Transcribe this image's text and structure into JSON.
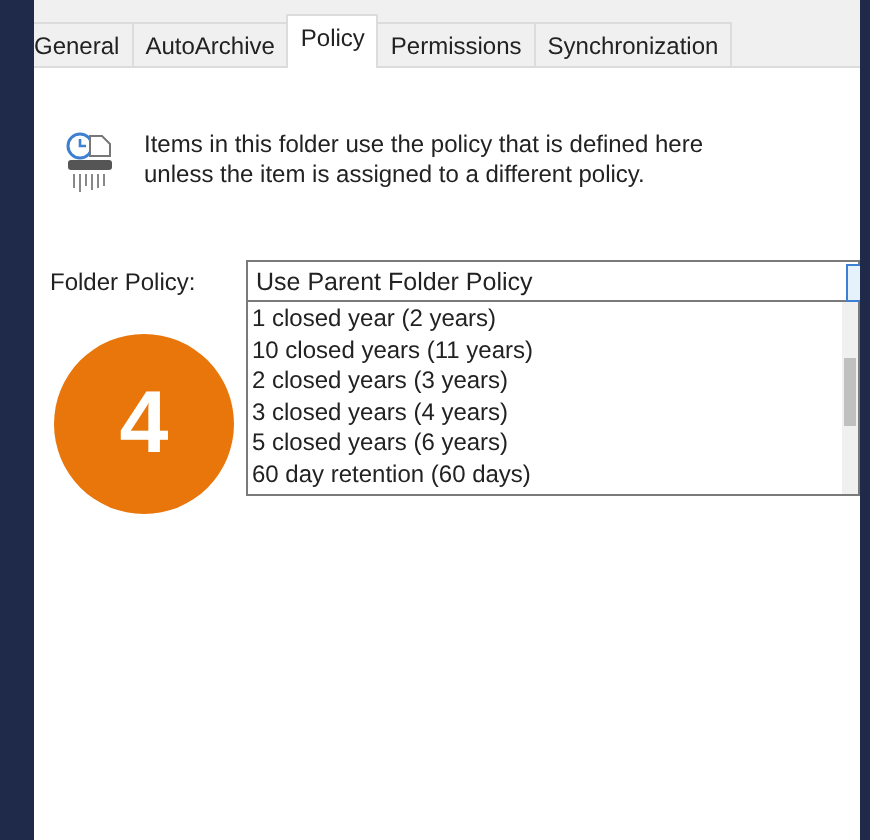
{
  "tabs": [
    {
      "label": "General",
      "selected": false
    },
    {
      "label": "AutoArchive",
      "selected": false
    },
    {
      "label": "Policy",
      "selected": true
    },
    {
      "label": "Permissions",
      "selected": false
    },
    {
      "label": "Synchronization",
      "selected": false
    }
  ],
  "info": "Items in this folder use the policy that is defined here unless the item is assigned to a different policy.",
  "folder_policy": {
    "label": "Folder Policy:",
    "value": "Use Parent Folder Policy",
    "options": [
      "1 closed year (2 years)",
      "10 closed years (11 years)",
      "2 closed years (3 years)",
      "3 closed years (4 years)",
      "5 closed years (6 years)",
      "60 day retention (60 days)"
    ]
  },
  "step_badge": "4"
}
